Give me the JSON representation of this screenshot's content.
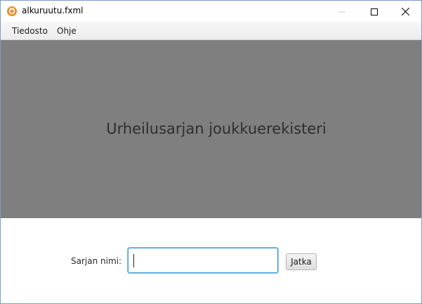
{
  "window": {
    "title": "alkuruutu.fxml",
    "icon": "app-logo-icon"
  },
  "menubar": {
    "items": [
      {
        "label": "Tiedosto"
      },
      {
        "label": "Ohje"
      }
    ]
  },
  "banner": {
    "title": "Urheilusarjan joukkuerekisteri"
  },
  "form": {
    "series_name_label": "Sarjan nimi:",
    "series_name_value": "",
    "continue_button": "Jatka"
  },
  "colors": {
    "banner_background": "#7f7f7f",
    "focus_accent": "#3a9ad9",
    "icon_accent": "#f28c28"
  }
}
